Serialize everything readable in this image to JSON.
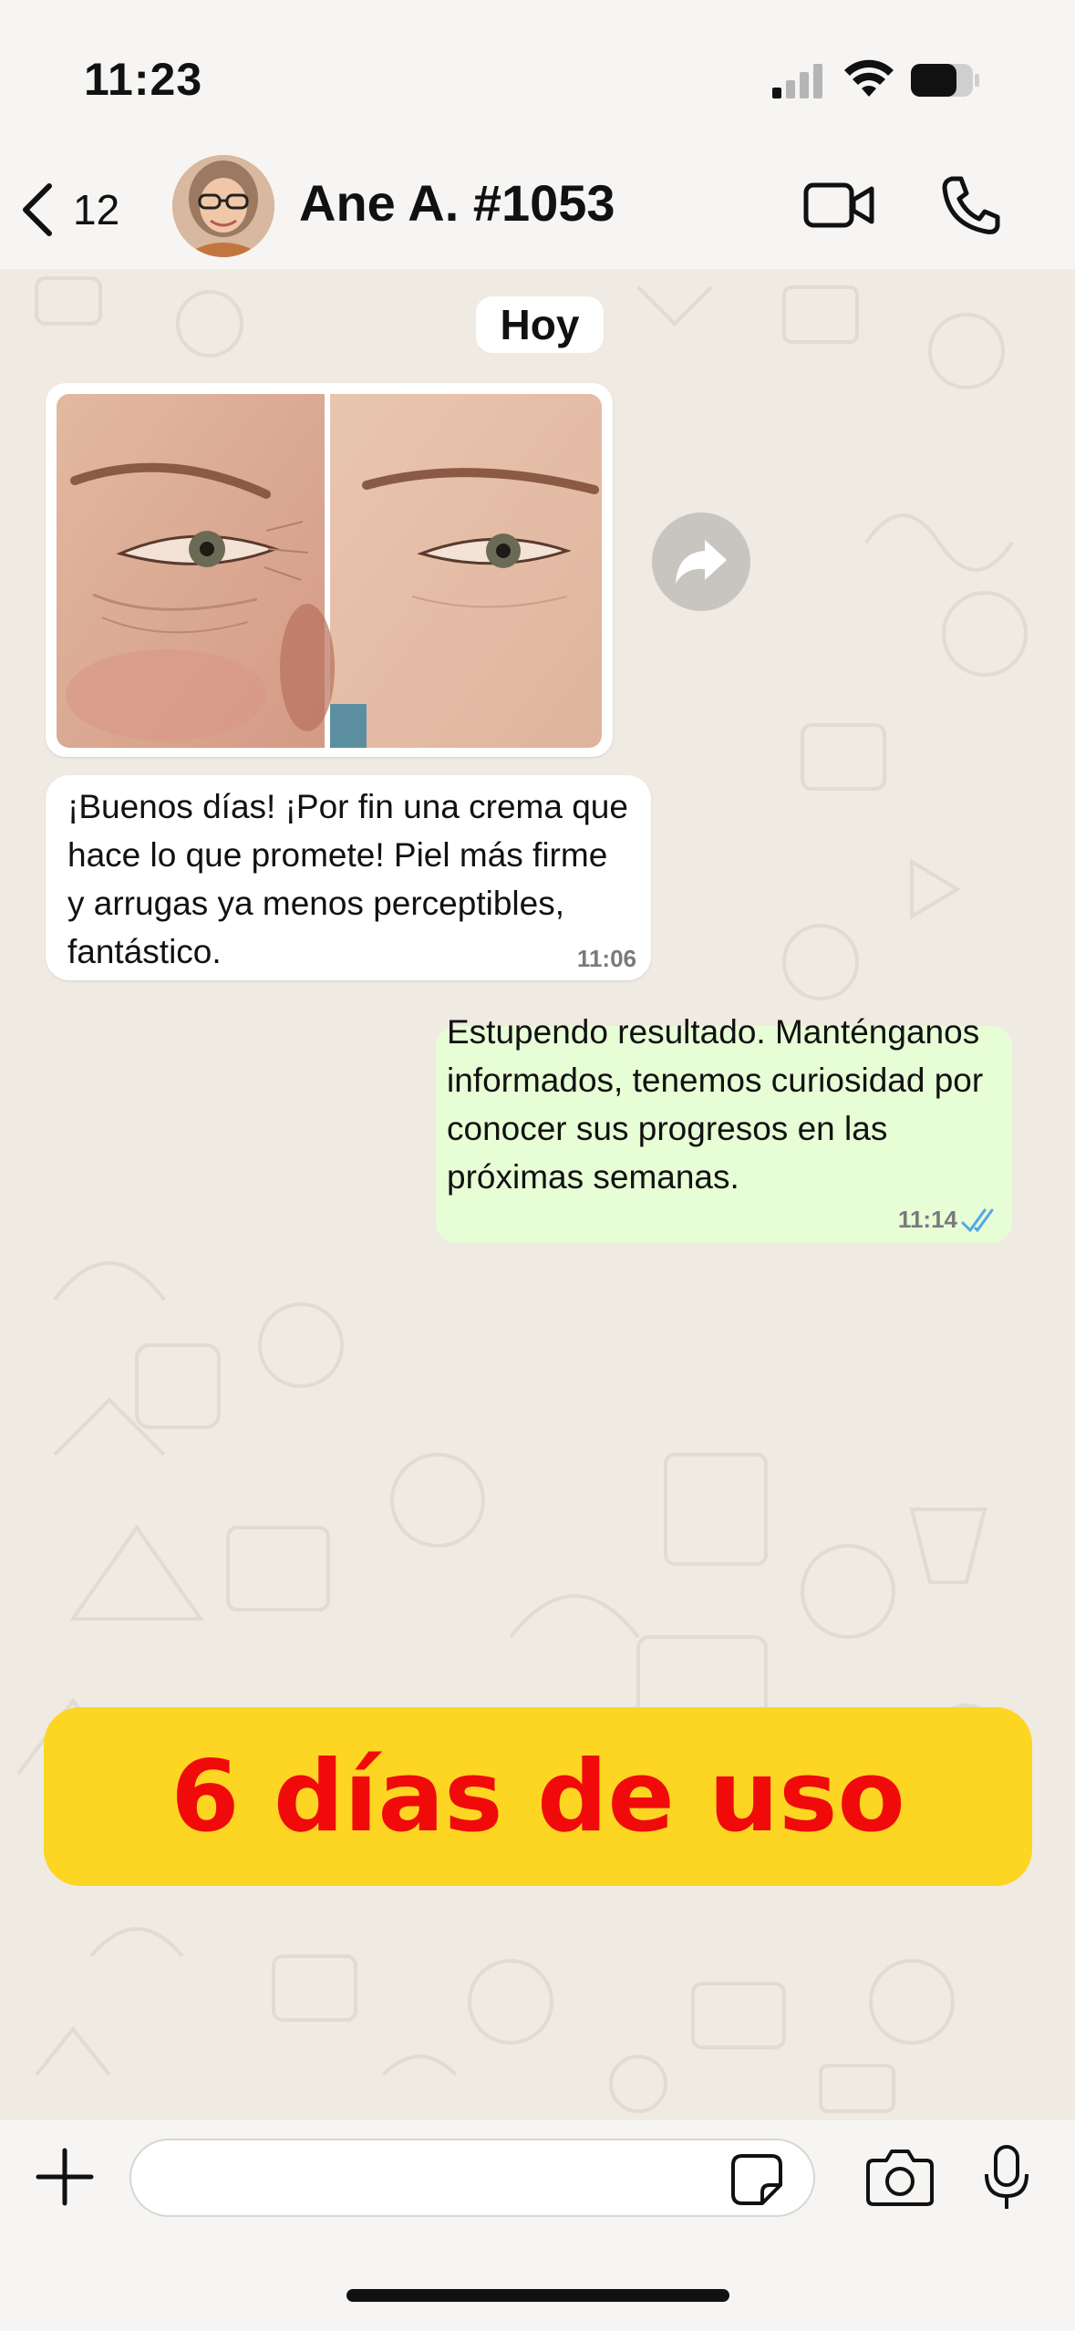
{
  "status_bar": {
    "time": "11:23",
    "icons": [
      "signal-icon",
      "wifi-icon",
      "battery-icon"
    ]
  },
  "header": {
    "back_count": "12",
    "contact_name": "Ane A. #1053",
    "actions": [
      "video-call-icon",
      "phone-icon"
    ]
  },
  "chat": {
    "date_label": "Hoy",
    "messages": [
      {
        "direction": "incoming",
        "type": "image",
        "content": "before-after eye skin photo"
      },
      {
        "direction": "incoming",
        "text": "¡Buenos días! ¡Por fin una crema que hace lo que promete! Piel más firme y arrugas ya menos perceptibles, fantástico.",
        "time": "11:06"
      },
      {
        "direction": "outgoing",
        "text": "Estupendo resultado. Manténganos informados, tenemos curiosidad por conocer sus progresos en las próximas semanas.",
        "time": "11:14",
        "status": "read"
      }
    ]
  },
  "banner": {
    "text": "6 días de uso",
    "background": "#fdd523",
    "color": "#f00a0a"
  },
  "input_bar": {
    "message_value": "",
    "icons": [
      "plus-icon",
      "sticker-icon",
      "camera-icon",
      "mic-icon"
    ]
  },
  "colors": {
    "chat_background": "#efeae2",
    "outgoing_bubble": "#e7fdd6",
    "incoming_bubble": "#ffffff",
    "read_ticks": "#53a6e8"
  }
}
